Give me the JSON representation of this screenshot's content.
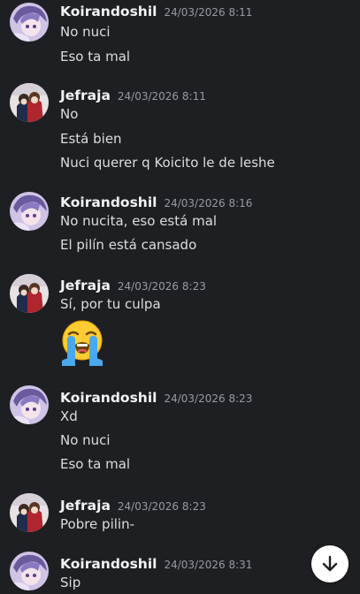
{
  "messages": [
    {
      "author": "Koirandoshil",
      "timestamp": "24/03/2026 8:11",
      "avatar": "koirandoshil-avatar",
      "lines": [
        "No nuci",
        "Eso ta mal"
      ]
    },
    {
      "author": "Jefraja",
      "timestamp": "24/03/2026 8:11",
      "avatar": "jefraja-avatar",
      "lines": [
        "No",
        "Está bien",
        "Nuci querer q Koicito le de leshe"
      ]
    },
    {
      "author": "Koirandoshil",
      "timestamp": "24/03/2026 8:16",
      "avatar": "koirandoshil-avatar",
      "lines": [
        "No nucita, eso está mal",
        "El pilín está cansado"
      ]
    },
    {
      "author": "Jefraja",
      "timestamp": "24/03/2026 8:23",
      "avatar": "jefraja-avatar",
      "lines": [
        "Sí, por tu culpa"
      ],
      "emoji": "loudly-crying-face-emoji"
    },
    {
      "author": "Koirandoshil",
      "timestamp": "24/03/2026 8:23",
      "avatar": "koirandoshil-avatar",
      "lines": [
        "Xd",
        "No nuci",
        "Eso ta mal"
      ]
    },
    {
      "author": "Jefraja",
      "timestamp": "24/03/2026 8:23",
      "avatar": "jefraja-avatar",
      "lines": [
        "Pobre pilin-"
      ]
    },
    {
      "author": "Koirandoshil",
      "timestamp": "24/03/2026 8:31",
      "avatar": "koirandoshil-avatar",
      "lines": [
        "Sip"
      ]
    }
  ],
  "scroll_button": {
    "icon": "arrow-down-icon"
  },
  "colors": {
    "background": "#1e1f22",
    "author": "#f2f3f5",
    "timestamp": "#949ba4",
    "text": "#dbdee1",
    "scroll_button": "#ffffff"
  }
}
